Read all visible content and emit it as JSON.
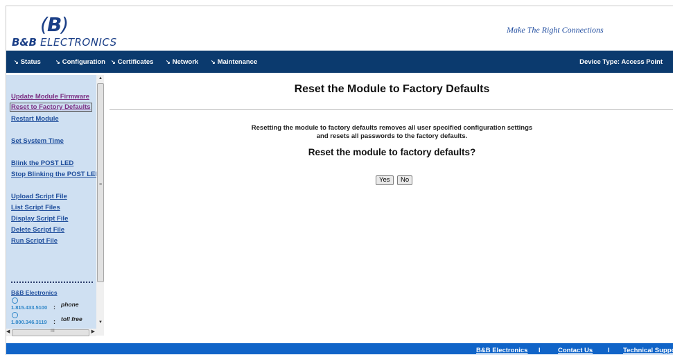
{
  "header": {
    "logo_mark": "B",
    "logo_bb": "B&B",
    "logo_electronics": "ELECTRONICS",
    "tagline": "Make The Right Connections"
  },
  "nav": {
    "items": [
      {
        "label": "Status"
      },
      {
        "label": "Configuration"
      },
      {
        "label": "Certificates"
      },
      {
        "label": "Network"
      },
      {
        "label": "Maintenance"
      }
    ],
    "device_type": "Device Type: Access Point"
  },
  "sidebar": {
    "links": [
      {
        "label": "Update Module Firmware"
      },
      {
        "label": "Reset to Factory Defaults"
      },
      {
        "label": "Restart Module"
      },
      {
        "label": "Set System Time"
      },
      {
        "label": "Blink the POST LED"
      },
      {
        "label": "Stop Blinking the POST LED"
      },
      {
        "label": "Upload Script File"
      },
      {
        "label": "List Script Files"
      },
      {
        "label": "Display Script File"
      },
      {
        "label": "Delete Script File"
      },
      {
        "label": "Run Script File"
      }
    ],
    "company": "B&B Electronics",
    "phones": [
      {
        "number": "1.815.433.5100",
        "sep": ":",
        "type": "phone"
      },
      {
        "number": "1.800.346.3119",
        "sep": ":",
        "type": "toll free"
      }
    ],
    "hscroll_grip": "III"
  },
  "main": {
    "title": "Reset the Module to Factory Defaults",
    "desc_line1": "Resetting the module to factory defaults removes all user specified configuration settings",
    "desc_line2": "and resets all passwords to the factory defaults.",
    "question": "Reset the module to factory defaults?",
    "yes_label": "Yes",
    "no_label": "No"
  },
  "footer": {
    "links": [
      {
        "label": "B&B Electronics"
      },
      {
        "label": "Contact Us"
      },
      {
        "label": "Technical Support"
      }
    ],
    "sep": "I"
  },
  "colors": {
    "navbar": "#0b3a6e",
    "sidebar": "#cfe0f2",
    "footer": "#1064c8",
    "link": "#1f4e9c",
    "visited_link": "#7b2f83"
  }
}
